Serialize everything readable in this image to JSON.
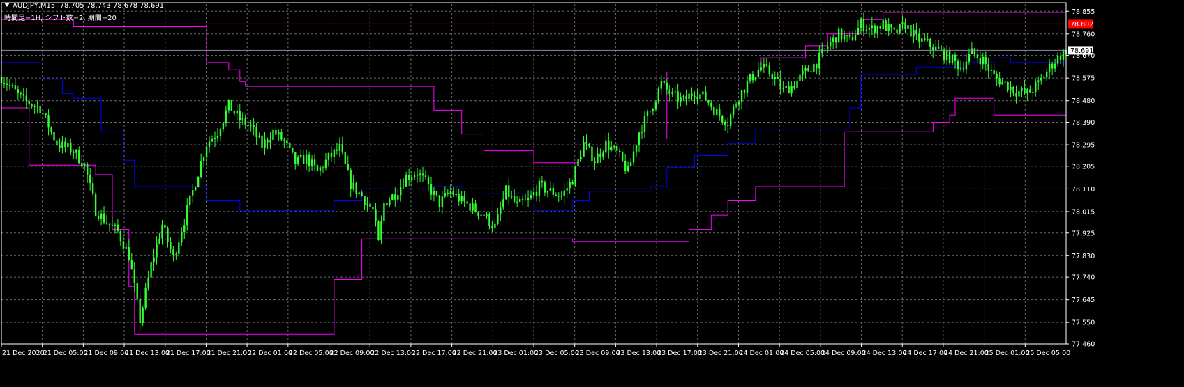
{
  "header": {
    "title": "AUDJPY,M15  78.705 78.743 78.678 78.691",
    "params": "時間足=1H, シフト数=2, 期間=20"
  },
  "colors": {
    "background": "#000000",
    "grid": "#6b6b6b",
    "axis": "#ffffff",
    "candle": "#33ff33",
    "upper_band": "#ff00ff",
    "lower_band": "#ff00ff",
    "mid_line": "#0000ff",
    "resistance": "#ff0000",
    "bid_line": "#8a8aa8",
    "price_label_bg": "#ffffff",
    "resistance_label_bg": "#ff0000"
  },
  "chart_data": {
    "type": "candlestick",
    "symbol": "AUDJPY",
    "timeframe": "M15",
    "ylim": [
      77.46,
      78.885
    ],
    "y_ticks": [
      "78.855",
      "78.760",
      "78.670",
      "78.575",
      "78.480",
      "78.390",
      "78.295",
      "78.205",
      "78.110",
      "78.015",
      "77.925",
      "77.830",
      "77.740",
      "77.645",
      "77.550",
      "77.460"
    ],
    "x_ticks": [
      "21 Dec 2020",
      "21 Dec 05:00",
      "21 Dec 09:00",
      "21 Dec 13:00",
      "21 Dec 17:00",
      "21 Dec 21:00",
      "22 Dec 01:00",
      "22 Dec 05:00",
      "22 Dec 09:00",
      "22 Dec 13:00",
      "22 Dec 17:00",
      "22 Dec 21:00",
      "23 Dec 01:00",
      "23 Dec 05:00",
      "23 Dec 09:00",
      "23 Dec 13:00",
      "23 Dec 17:00",
      "23 Dec 21:00",
      "24 Dec 01:00",
      "24 Dec 05:00",
      "24 Dec 09:00",
      "24 Dec 13:00",
      "24 Dec 17:00",
      "24 Dec 21:00",
      "25 Dec 01:00",
      "25 Dec 05:00"
    ],
    "current_price": "78.691",
    "resistance_price": "78.802",
    "close_path": [
      [
        0,
        78.58
      ],
      [
        8,
        78.48
      ],
      [
        14,
        78.45
      ],
      [
        20,
        78.3
      ],
      [
        26,
        78.27
      ],
      [
        30,
        78.21
      ],
      [
        34,
        78.02
      ],
      [
        38,
        77.97
      ],
      [
        42,
        77.93
      ],
      [
        46,
        77.83
      ],
      [
        50,
        77.56
      ],
      [
        54,
        77.79
      ],
      [
        58,
        77.96
      ],
      [
        62,
        77.82
      ],
      [
        66,
        77.98
      ],
      [
        70,
        78.14
      ],
      [
        74,
        78.3
      ],
      [
        78,
        78.35
      ],
      [
        82,
        78.46
      ],
      [
        86,
        78.4
      ],
      [
        90,
        78.37
      ],
      [
        94,
        78.29
      ],
      [
        98,
        78.35
      ],
      [
        102,
        78.31
      ],
      [
        106,
        78.22
      ],
      [
        110,
        78.24
      ],
      [
        114,
        78.18
      ],
      [
        118,
        78.24
      ],
      [
        122,
        78.28
      ],
      [
        126,
        78.13
      ],
      [
        130,
        78.08
      ],
      [
        134,
        78.02
      ],
      [
        136,
        77.88
      ],
      [
        138,
        78.05
      ],
      [
        142,
        78.09
      ],
      [
        146,
        78.16
      ],
      [
        150,
        78.18
      ],
      [
        154,
        78.12
      ],
      [
        158,
        78.05
      ],
      [
        162,
        78.1
      ],
      [
        166,
        78.06
      ],
      [
        170,
        78.03
      ],
      [
        174,
        78.0
      ],
      [
        178,
        77.95
      ],
      [
        182,
        78.1
      ],
      [
        186,
        78.04
      ],
      [
        190,
        78.06
      ],
      [
        194,
        78.12
      ],
      [
        198,
        78.1
      ],
      [
        202,
        78.08
      ],
      [
        206,
        78.15
      ],
      [
        210,
        78.3
      ],
      [
        214,
        78.23
      ],
      [
        218,
        78.3
      ],
      [
        222,
        78.26
      ],
      [
        226,
        78.18
      ],
      [
        230,
        78.35
      ],
      [
        234,
        78.44
      ],
      [
        238,
        78.55
      ],
      [
        242,
        78.5
      ],
      [
        246,
        78.48
      ],
      [
        250,
        78.52
      ],
      [
        254,
        78.49
      ],
      [
        258,
        78.43
      ],
      [
        262,
        78.39
      ],
      [
        266,
        78.5
      ],
      [
        270,
        78.57
      ],
      [
        274,
        78.62
      ],
      [
        278,
        78.59
      ],
      [
        282,
        78.52
      ],
      [
        286,
        78.55
      ],
      [
        290,
        78.6
      ],
      [
        294,
        78.64
      ],
      [
        298,
        78.71
      ],
      [
        302,
        78.76
      ],
      [
        306,
        78.73
      ],
      [
        310,
        78.8
      ],
      [
        314,
        78.78
      ],
      [
        318,
        78.8
      ],
      [
        322,
        78.76
      ],
      [
        326,
        78.8
      ],
      [
        330,
        78.74
      ],
      [
        334,
        78.72
      ],
      [
        338,
        78.69
      ],
      [
        342,
        78.66
      ],
      [
        346,
        78.62
      ],
      [
        350,
        78.68
      ],
      [
        354,
        78.65
      ],
      [
        358,
        78.58
      ],
      [
        362,
        78.55
      ],
      [
        366,
        78.52
      ],
      [
        370,
        78.51
      ],
      [
        374,
        78.55
      ],
      [
        378,
        78.62
      ],
      [
        381,
        78.66
      ],
      [
        384,
        78.691
      ]
    ],
    "upper_band": [
      [
        0,
        78.82
      ],
      [
        26,
        78.82
      ],
      [
        26,
        78.79
      ],
      [
        74,
        78.79
      ],
      [
        74,
        78.64
      ],
      [
        82,
        78.64
      ],
      [
        82,
        78.61
      ],
      [
        86,
        78.61
      ],
      [
        86,
        78.56
      ],
      [
        88,
        78.56
      ],
      [
        88,
        78.54
      ],
      [
        156,
        78.54
      ],
      [
        156,
        78.44
      ],
      [
        166,
        78.44
      ],
      [
        166,
        78.34
      ],
      [
        174,
        78.34
      ],
      [
        174,
        78.27
      ],
      [
        192,
        78.27
      ],
      [
        192,
        78.22
      ],
      [
        208,
        78.22
      ],
      [
        208,
        78.32
      ],
      [
        240,
        78.32
      ],
      [
        240,
        78.6
      ],
      [
        274,
        78.6
      ],
      [
        274,
        78.66
      ],
      [
        290,
        78.66
      ],
      [
        290,
        78.71
      ],
      [
        298,
        78.71
      ],
      [
        298,
        78.76
      ],
      [
        310,
        78.76
      ],
      [
        310,
        78.82
      ],
      [
        318,
        78.82
      ],
      [
        318,
        78.85
      ],
      [
        384,
        78.85
      ]
    ],
    "lower_band": [
      [
        0,
        78.45
      ],
      [
        10,
        78.45
      ],
      [
        10,
        78.21
      ],
      [
        34,
        78.21
      ],
      [
        34,
        78.17
      ],
      [
        40,
        78.17
      ],
      [
        40,
        77.94
      ],
      [
        46,
        77.94
      ],
      [
        46,
        77.7
      ],
      [
        48,
        77.7
      ],
      [
        48,
        77.5
      ],
      [
        120,
        77.5
      ],
      [
        120,
        77.73
      ],
      [
        130,
        77.73
      ],
      [
        130,
        77.9
      ],
      [
        206,
        77.9
      ],
      [
        206,
        77.89
      ],
      [
        248,
        77.89
      ],
      [
        248,
        77.94
      ],
      [
        256,
        77.94
      ],
      [
        256,
        78.0
      ],
      [
        262,
        78.0
      ],
      [
        262,
        78.06
      ],
      [
        272,
        78.06
      ],
      [
        272,
        78.12
      ],
      [
        304,
        78.12
      ],
      [
        304,
        78.35
      ],
      [
        336,
        78.35
      ],
      [
        336,
        78.39
      ],
      [
        342,
        78.39
      ],
      [
        342,
        78.42
      ],
      [
        344,
        78.42
      ],
      [
        344,
        78.49
      ],
      [
        358,
        78.49
      ],
      [
        358,
        78.42
      ],
      [
        384,
        78.42
      ]
    ],
    "mid_line": [
      [
        0,
        78.64
      ],
      [
        14,
        78.64
      ],
      [
        14,
        78.57
      ],
      [
        22,
        78.57
      ],
      [
        22,
        78.51
      ],
      [
        26,
        78.51
      ],
      [
        26,
        78.49
      ],
      [
        36,
        78.49
      ],
      [
        36,
        78.35
      ],
      [
        44,
        78.35
      ],
      [
        44,
        78.23
      ],
      [
        48,
        78.23
      ],
      [
        48,
        78.12
      ],
      [
        74,
        78.12
      ],
      [
        74,
        78.06
      ],
      [
        86,
        78.06
      ],
      [
        86,
        78.02
      ],
      [
        120,
        78.02
      ],
      [
        120,
        78.06
      ],
      [
        130,
        78.06
      ],
      [
        130,
        78.11
      ],
      [
        156,
        78.11
      ],
      [
        156,
        78.12
      ],
      [
        166,
        78.12
      ],
      [
        166,
        78.11
      ],
      [
        174,
        78.11
      ],
      [
        174,
        78.09
      ],
      [
        192,
        78.09
      ],
      [
        192,
        78.02
      ],
      [
        206,
        78.02
      ],
      [
        206,
        78.06
      ],
      [
        212,
        78.06
      ],
      [
        212,
        78.1
      ],
      [
        234,
        78.1
      ],
      [
        234,
        78.12
      ],
      [
        240,
        78.12
      ],
      [
        240,
        78.2
      ],
      [
        250,
        78.2
      ],
      [
        250,
        78.25
      ],
      [
        262,
        78.25
      ],
      [
        262,
        78.3
      ],
      [
        272,
        78.3
      ],
      [
        272,
        78.36
      ],
      [
        306,
        78.36
      ],
      [
        306,
        78.45
      ],
      [
        310,
        78.45
      ],
      [
        310,
        78.59
      ],
      [
        330,
        78.59
      ],
      [
        330,
        78.62
      ],
      [
        348,
        78.62
      ],
      [
        348,
        78.64
      ],
      [
        358,
        78.64
      ],
      [
        358,
        78.66
      ],
      [
        364,
        78.66
      ],
      [
        364,
        78.64
      ],
      [
        384,
        78.64
      ]
    ]
  }
}
